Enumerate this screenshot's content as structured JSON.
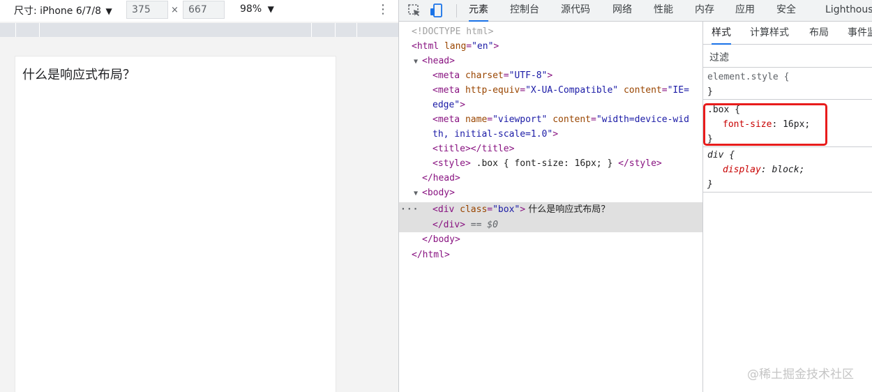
{
  "device_toolbar": {
    "preset_label": "尺寸: iPhone 6/7/8",
    "preset_caret": "▼",
    "width_value": "375",
    "times": "×",
    "height_value": "667",
    "zoom_label": "98%",
    "zoom_caret": "▼",
    "more_icon": "⋮"
  },
  "viewport": {
    "box_text": "什么是响应式布局？"
  },
  "devtools": {
    "toolbar": {
      "inspect_icon": "select-element-icon",
      "device_icon": "device-toolbar-icon",
      "tabs": [
        "元素",
        "控制台",
        "源代码",
        "网络",
        "性能",
        "内存",
        "应用",
        "安全",
        "Lighthouse"
      ],
      "active_tab": "元素",
      "accent_color": "#1a73e8"
    },
    "elements": {
      "doctype": "<!DOCTYPE html>",
      "html_open_tag": "<html",
      "html_lang_attr": "lang",
      "html_lang_val": "\"en\"",
      "close_angle": ">",
      "head_tag": "<head>",
      "meta1_tag": "<meta",
      "meta1_attr": "charset",
      "meta1_val": "\"UTF-8\"",
      "meta2_tag": "<meta",
      "meta2_attr1": "http-equiv",
      "meta2_val1": "\"X-UA-Compatible\"",
      "meta2_attr2": "content",
      "meta2_val2_part1": "\"IE=",
      "meta2_val2_part2": "edge\"",
      "meta3_tag": "<meta",
      "meta3_attr1": "name",
      "meta3_val1": "\"viewport\"",
      "meta3_attr2": "content",
      "meta3_val2_part1": "\"width=device-wid",
      "meta3_val2_part2": "th, initial-scale=1.0\"",
      "title_tags": "<title></title>",
      "style_open": "<style>",
      "style_content": " .box { font-size: 16px; } ",
      "style_close": "</style>",
      "head_close": "</head>",
      "body_tag": "<body>",
      "div_open_tag": "<div",
      "div_attr": "class",
      "div_val": "\"box\"",
      "div_text": " 什么是响应式布局？",
      "div_close": "</div>",
      "dollar_zero": "== $0",
      "row_dots": "···",
      "body_close": "</body>",
      "html_close": "</html>"
    },
    "styles": {
      "tabs": [
        "样式",
        "计算样式",
        "布局",
        "事件监"
      ],
      "active_tab": "样式",
      "filter_placeholder": "过滤",
      "element_style_selector": "element.style {",
      "close_brace": "}",
      "box_selector": ".box {",
      "box_prop": "font-size",
      "box_value": "16px;",
      "div_selector": "div {",
      "div_prop": "display",
      "div_value": "block;",
      "highlight_color": "#e81c1c"
    }
  },
  "watermark": "@稀土掘金技术社区"
}
